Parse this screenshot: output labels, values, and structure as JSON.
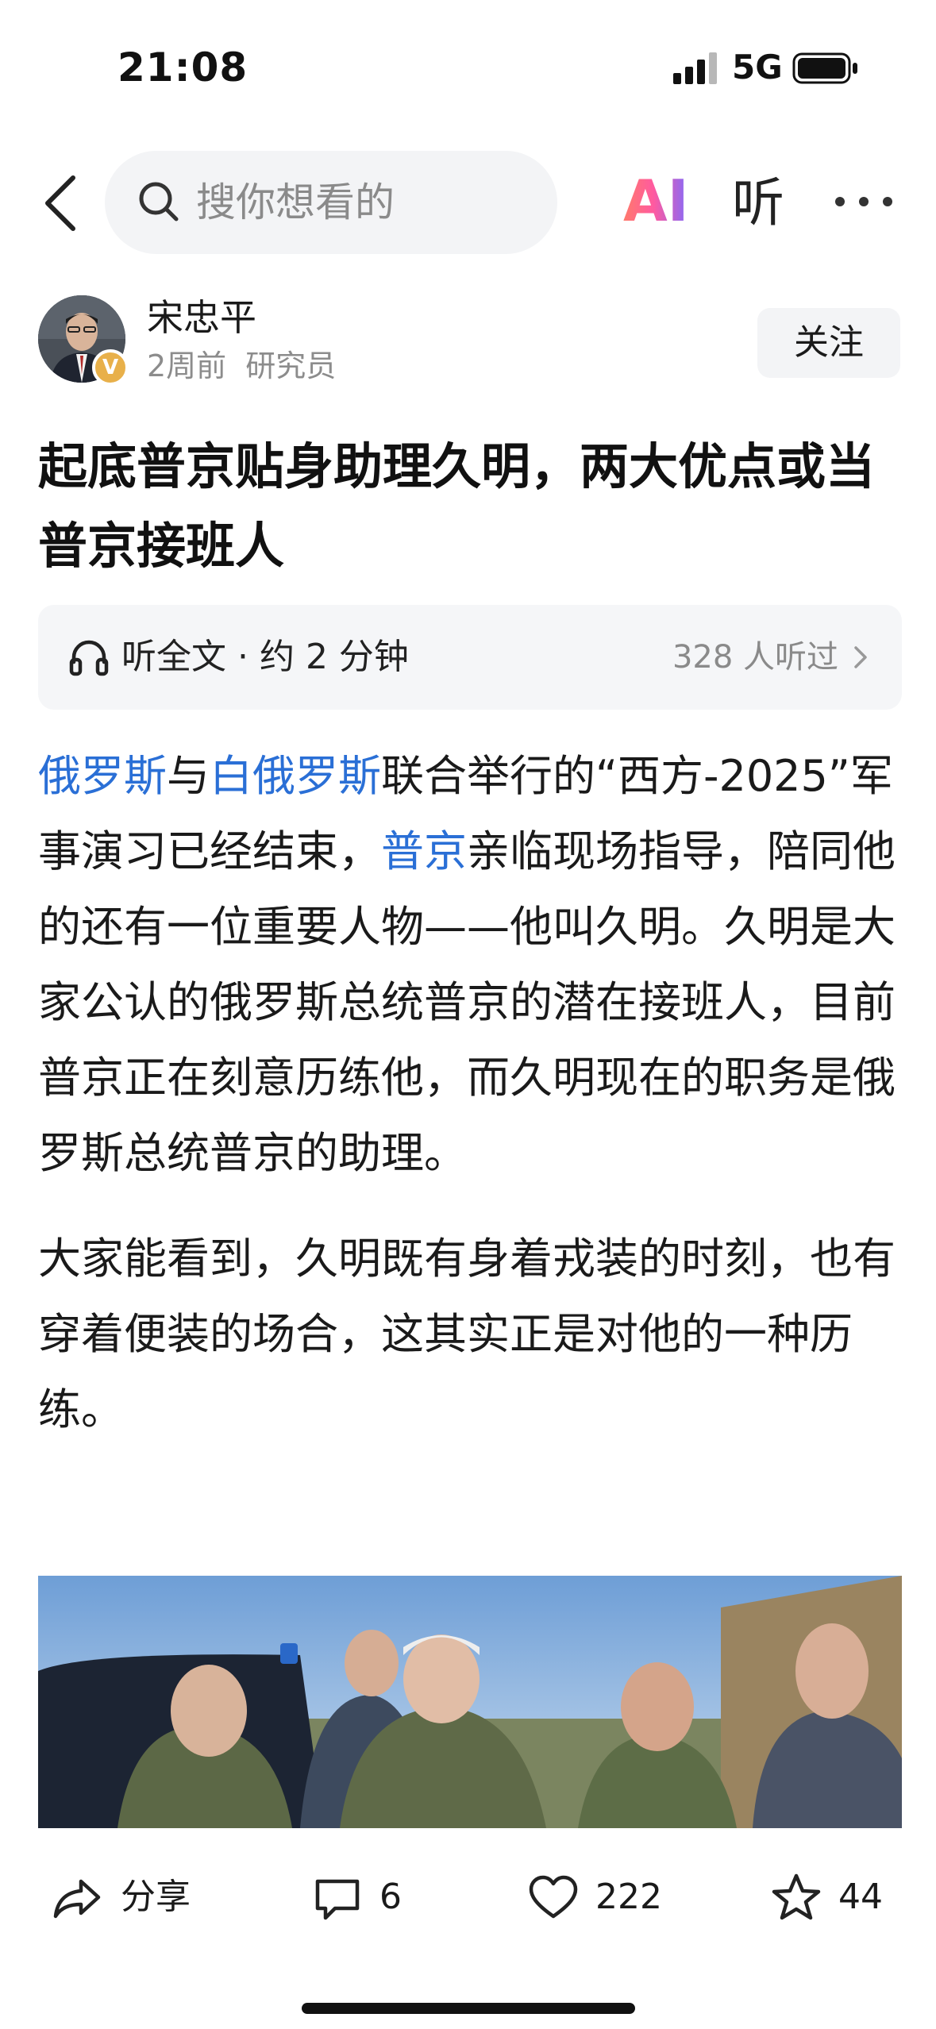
{
  "status_bar": {
    "time": "21:08",
    "network": "5G"
  },
  "nav": {
    "search_placeholder": "搜你想看的",
    "ai_label": "AI",
    "listen_label": "听"
  },
  "author": {
    "name": "宋忠平",
    "time": "2周前",
    "role": "研究员",
    "badge": "V",
    "follow_label": "关注"
  },
  "article": {
    "title": "起底普京贴身助理久明，两大优点或当普京接班人",
    "listen_card": {
      "label": "听全文 · 约 2 分钟",
      "count": "328 人听过"
    },
    "p1": {
      "link1": "俄罗斯",
      "t1": "与",
      "link2": "白俄罗斯",
      "t2": "联合举行的“西方-2025”军事演习已经结束，",
      "link3": "普京",
      "t3": "亲临现场指导，陪同他的还有一位重要人物——他叫久明。久明是大家公认的俄罗斯总统普京的潜在接班人，目前普京正在刻意历练他，而久明现在的职务是俄罗斯总统普京的助理。"
    },
    "p2": "大家能看到，久明既有身着戎装的时刻，也有穿着便装的场合，这其实正是对他的一种历练。"
  },
  "actions": {
    "share_label": "分享",
    "comment_count": "6",
    "like_count": "222",
    "favorite_count": "44"
  },
  "colors": {
    "link": "#2a6fd6",
    "muted": "#8c8c8c",
    "card_bg": "#f5f6f8"
  }
}
